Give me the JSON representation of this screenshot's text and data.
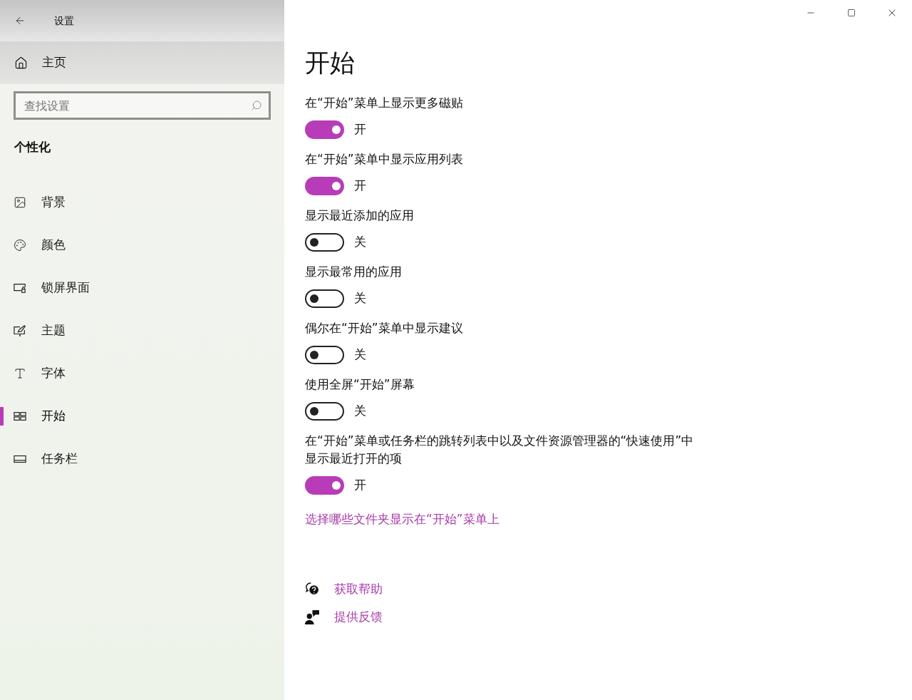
{
  "window": {
    "title": "设置"
  },
  "sidebar": {
    "home": "主页",
    "search": {
      "placeholder": "查找设置"
    },
    "section": "个性化",
    "items": [
      {
        "label": "背景",
        "selected": false
      },
      {
        "label": "颜色",
        "selected": false
      },
      {
        "label": "锁屏界面",
        "selected": false
      },
      {
        "label": "主题",
        "selected": false
      },
      {
        "label": "字体",
        "selected": false
      },
      {
        "label": "开始",
        "selected": true
      },
      {
        "label": "任务栏",
        "selected": false
      }
    ]
  },
  "page": {
    "title": "开始",
    "settings": [
      {
        "label": "在“开始”菜单上显示更多磁贴",
        "on": true,
        "state": "开"
      },
      {
        "label": "在“开始”菜单中显示应用列表",
        "on": true,
        "state": "开"
      },
      {
        "label": "显示最近添加的应用",
        "on": false,
        "state": "关"
      },
      {
        "label": "显示最常用的应用",
        "on": false,
        "state": "关"
      },
      {
        "label": "偶尔在“开始”菜单中显示建议",
        "on": false,
        "state": "关"
      },
      {
        "label": "使用全屏“开始”屏幕",
        "on": false,
        "state": "关"
      },
      {
        "label": "在“开始”菜单或任务栏的跳转列表中以及文件资源管理器的“快速使用”中显示最近打开的项",
        "on": true,
        "state": "开"
      }
    ],
    "link": "选择哪些文件夹显示在“开始”菜单上",
    "help": [
      {
        "label": "获取帮助"
      },
      {
        "label": "提供反馈"
      }
    ]
  }
}
